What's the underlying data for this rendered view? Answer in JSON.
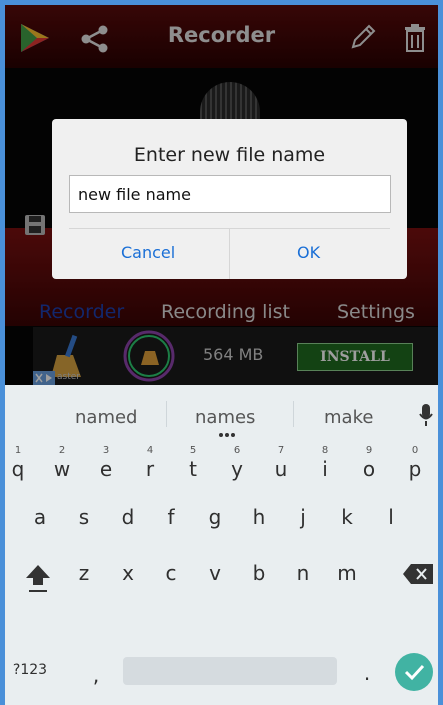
{
  "appbar": {
    "title": "Recorder"
  },
  "tabs": [
    {
      "label": "Recorder",
      "active": true
    },
    {
      "label": "Recording list",
      "active": false
    },
    {
      "label": "Settings",
      "active": false
    }
  ],
  "ad": {
    "size": "564 MB",
    "install": "INSTALL",
    "tiny": "aster"
  },
  "dialog": {
    "title": "Enter new file name",
    "value": "new file name",
    "cancel": "Cancel",
    "ok": "OK"
  },
  "keyboard": {
    "suggestions": [
      "named",
      "names",
      "make"
    ],
    "row1": [
      "q",
      "w",
      "e",
      "r",
      "t",
      "y",
      "u",
      "i",
      "o",
      "p"
    ],
    "row1_hints": [
      "1",
      "2",
      "3",
      "4",
      "5",
      "6",
      "7",
      "8",
      "9",
      "0"
    ],
    "row2": [
      "a",
      "s",
      "d",
      "f",
      "g",
      "h",
      "j",
      "k",
      "l"
    ],
    "row3": [
      "z",
      "x",
      "c",
      "v",
      "b",
      "n",
      "m"
    ],
    "symbols": "?123",
    "comma": ",",
    "period": "."
  },
  "colors": {
    "accent": "#1a6fd6",
    "enter": "#41b3a3",
    "appbar": "#5a0b0b"
  }
}
